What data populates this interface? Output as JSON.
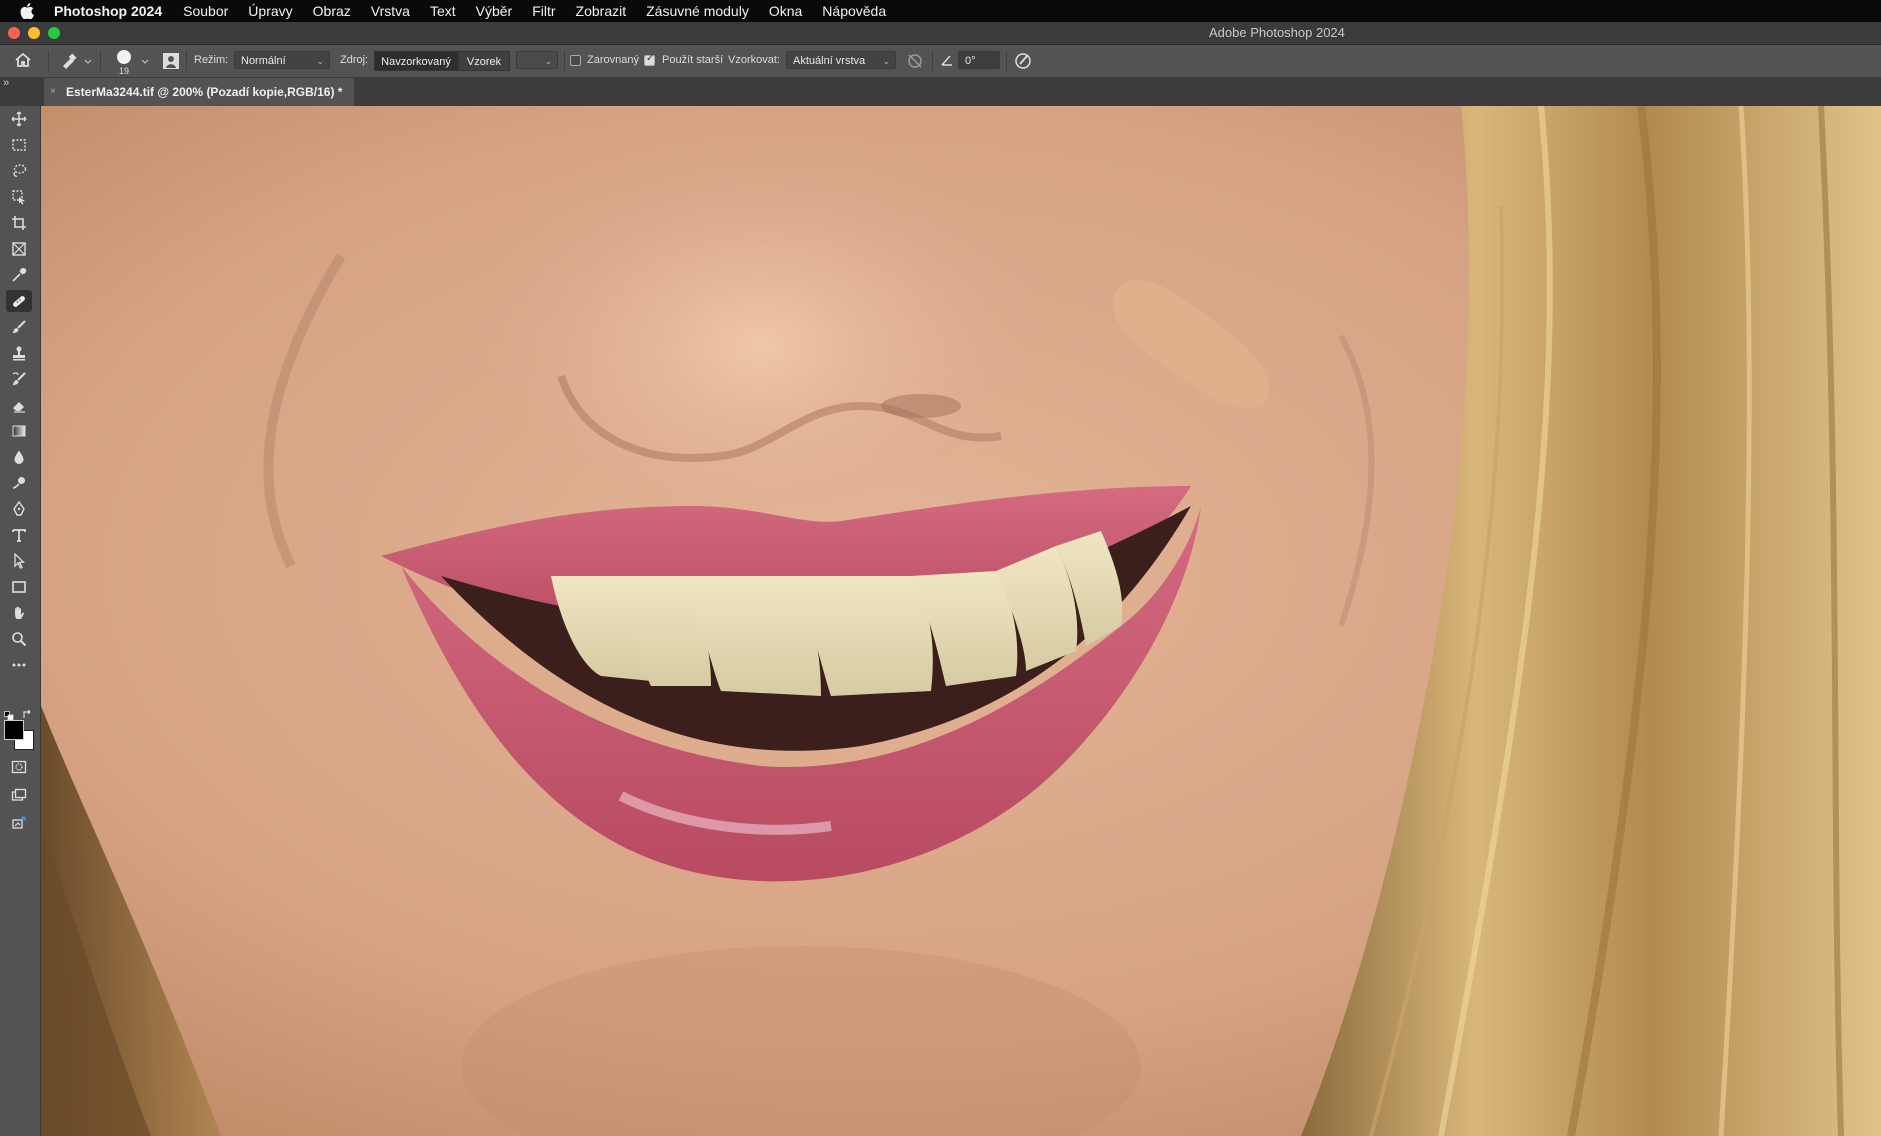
{
  "menubar": {
    "app_name": "Photoshop 2024",
    "items": [
      "Soubor",
      "Úpravy",
      "Obraz",
      "Vrstva",
      "Text",
      "Výběr",
      "Filtr",
      "Zobrazit",
      "Zásuvné moduly",
      "Okna",
      "Nápověda"
    ]
  },
  "window": {
    "title": "Adobe Photoshop 2024"
  },
  "options": {
    "brush_size": "19",
    "mode_label": "Režim:",
    "mode_value": "Normální",
    "source_label": "Zdroj:",
    "source_sampled": "Navzorkovaný",
    "source_pattern": "Vzorek",
    "aligned_label": "Zarovnaný",
    "aligned_checked": false,
    "use_legacy_label": "Použít starší",
    "use_legacy_checked": true,
    "sample_label": "Vzorkovat:",
    "sample_value": "Aktuální vrstva",
    "angle_value": "0°"
  },
  "document": {
    "tab_title": "EsterMa3244.tif @ 200% (Pozadí kopie,RGB/16) *",
    "zoom_percent": 200
  },
  "toolbar": {
    "tools": [
      "move-tool",
      "marquee-tool",
      "lasso-tool",
      "object-selection-tool",
      "crop-tool",
      "frame-tool",
      "eyedropper-tool",
      "healing-brush-tool",
      "brush-tool",
      "clone-stamp-tool",
      "history-brush-tool",
      "eraser-tool",
      "gradient-tool",
      "blur-tool",
      "dodge-tool",
      "pen-tool",
      "type-tool",
      "path-selection-tool",
      "rectangle-tool",
      "hand-tool",
      "zoom-tool",
      "edit-toolbar"
    ],
    "active_tool": "healing-brush-tool",
    "foreground_color": "#000000",
    "background_color": "#ffffff"
  }
}
